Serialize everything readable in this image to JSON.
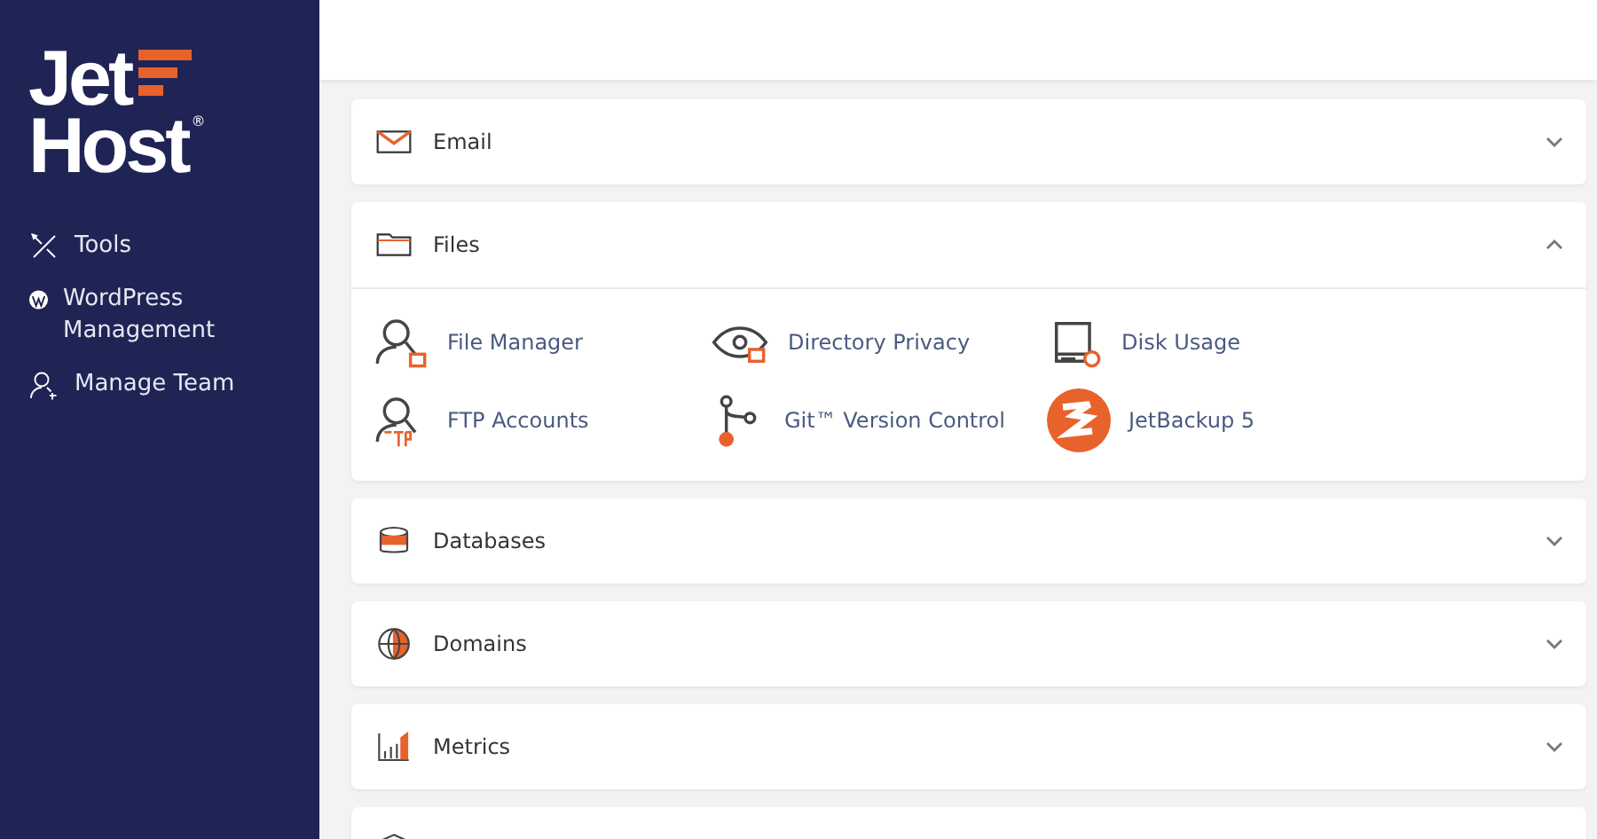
{
  "logo": {
    "line_1": "Jet",
    "line_2": "Host",
    "mark": "®"
  },
  "sidebar": {
    "items": [
      {
        "label": "Tools",
        "kind": "tools"
      },
      {
        "label": "WordPress Management",
        "kind": "wordpress"
      },
      {
        "label": "Manage Team",
        "kind": "team"
      }
    ]
  },
  "sections": [
    {
      "title": "Email",
      "kind": "email",
      "expanded": false
    },
    {
      "title": "Files",
      "kind": "files",
      "expanded": true,
      "items": [
        {
          "label": "File Manager",
          "kind": "filemanager"
        },
        {
          "label": "Directory Privacy",
          "kind": "privacy"
        },
        {
          "label": "Disk Usage",
          "kind": "disk"
        },
        {
          "label": "FTP Accounts",
          "kind": "ftp"
        },
        {
          "label": "Git™ Version Control",
          "kind": "git"
        },
        {
          "label": "JetBackup 5",
          "kind": "backup"
        }
      ]
    },
    {
      "title": "Databases",
      "kind": "databases",
      "expanded": false
    },
    {
      "title": "Domains",
      "kind": "domains",
      "expanded": false
    },
    {
      "title": "Metrics",
      "kind": "metrics",
      "expanded": false
    },
    {
      "kind": "security"
    }
  ]
}
